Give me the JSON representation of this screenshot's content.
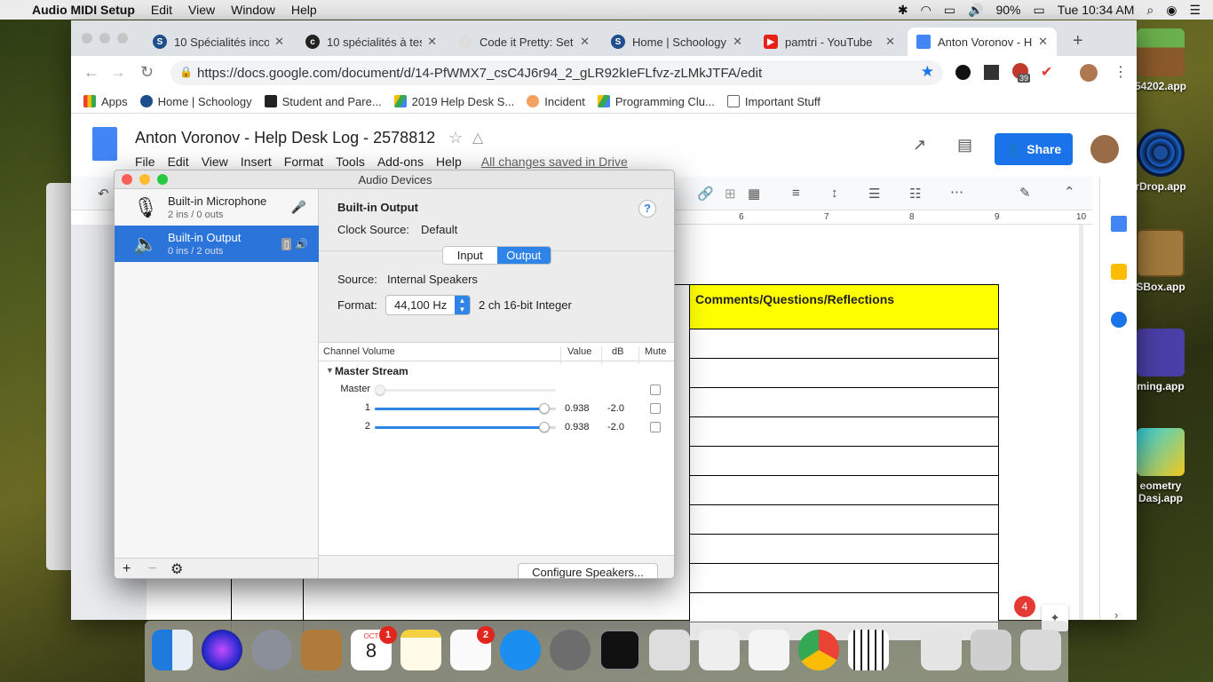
{
  "menubar": {
    "apple": "",
    "app_name": "Audio MIDI Setup",
    "items": [
      "Edit",
      "View",
      "Window",
      "Help"
    ],
    "battery": "90%",
    "clock": "Tue 10:34 AM"
  },
  "desktop_icons": [
    {
      "label": "54202.app"
    },
    {
      "label": "rDrop.app"
    },
    {
      "label": "SBox.app"
    },
    {
      "label": "ming.app"
    },
    {
      "label": "eometry"
    },
    {
      "label": "Dasj.app"
    }
  ],
  "browser": {
    "tabs": [
      {
        "title": "10 Spécialités inco",
        "active": false
      },
      {
        "title": "10 spécialités à tes",
        "active": false
      },
      {
        "title": "Code it Pretty: Set",
        "active": false
      },
      {
        "title": "Home | Schoology",
        "active": false
      },
      {
        "title": "pamtri - YouTube",
        "active": false
      },
      {
        "title": "Anton Voronov - H",
        "active": true
      }
    ],
    "url": "https://docs.google.com/document/d/14-PfWMX7_csC4J6r94_2_gLR92kIeFLfvz-zLMkJTFA/edit",
    "ext_badge": "39",
    "bookmarks": [
      "Apps",
      "Home | Schoology",
      "Student and Pare...",
      "2019 Help Desk S...",
      "Incident",
      "Programming Clu...",
      "Important Stuff"
    ]
  },
  "doc": {
    "title": "Anton Voronov - Help Desk Log - 2578812",
    "menu": [
      "File",
      "Edit",
      "View",
      "Insert",
      "Format",
      "Tools",
      "Add-ons",
      "Help"
    ],
    "saved_status": "All changes saved in Drive",
    "share_label": "Share",
    "ruler_marks": [
      "6",
      "7",
      "8",
      "9",
      "10"
    ],
    "table_header": "Comments/Questions/Reflections",
    "notification_count": "4"
  },
  "midi": {
    "window_title": "Audio Devices",
    "devices": [
      {
        "name": "Built-in Microphone",
        "io": "2 ins / 0 outs",
        "selected": false
      },
      {
        "name": "Built-in Output",
        "io": "0 ins / 2 outs",
        "selected": true
      }
    ],
    "footer_buttons": [
      "+",
      "−",
      "⚙"
    ],
    "detail": {
      "device_name": "Built-in Output",
      "clock_label": "Clock Source:",
      "clock_value": "Default",
      "segments": [
        "Input",
        "Output"
      ],
      "selected_segment": "Output",
      "source_label": "Source:",
      "source_value": "Internal Speakers",
      "format_label": "Format:",
      "format_rate": "44,100 Hz",
      "format_bits": "2 ch 16-bit Integer",
      "columns": [
        "Channel Volume",
        "Value",
        "dB",
        "Mute"
      ],
      "stream": "Master Stream",
      "channels": [
        {
          "name": "Master",
          "value": "",
          "db": "",
          "level": 0,
          "enabled": false,
          "muted": false
        },
        {
          "name": "1",
          "value": "0.938",
          "db": "-2.0",
          "level": 0.938,
          "enabled": true,
          "muted": false
        },
        {
          "name": "2",
          "value": "0.938",
          "db": "-2.0",
          "level": 0.938,
          "enabled": true,
          "muted": false
        }
      ],
      "configure_label": "Configure Speakers..."
    }
  },
  "dock": {
    "calendar_month": "OCT",
    "calendar_day": "8",
    "calendar_badge": "1",
    "reminders_badge": "2"
  }
}
